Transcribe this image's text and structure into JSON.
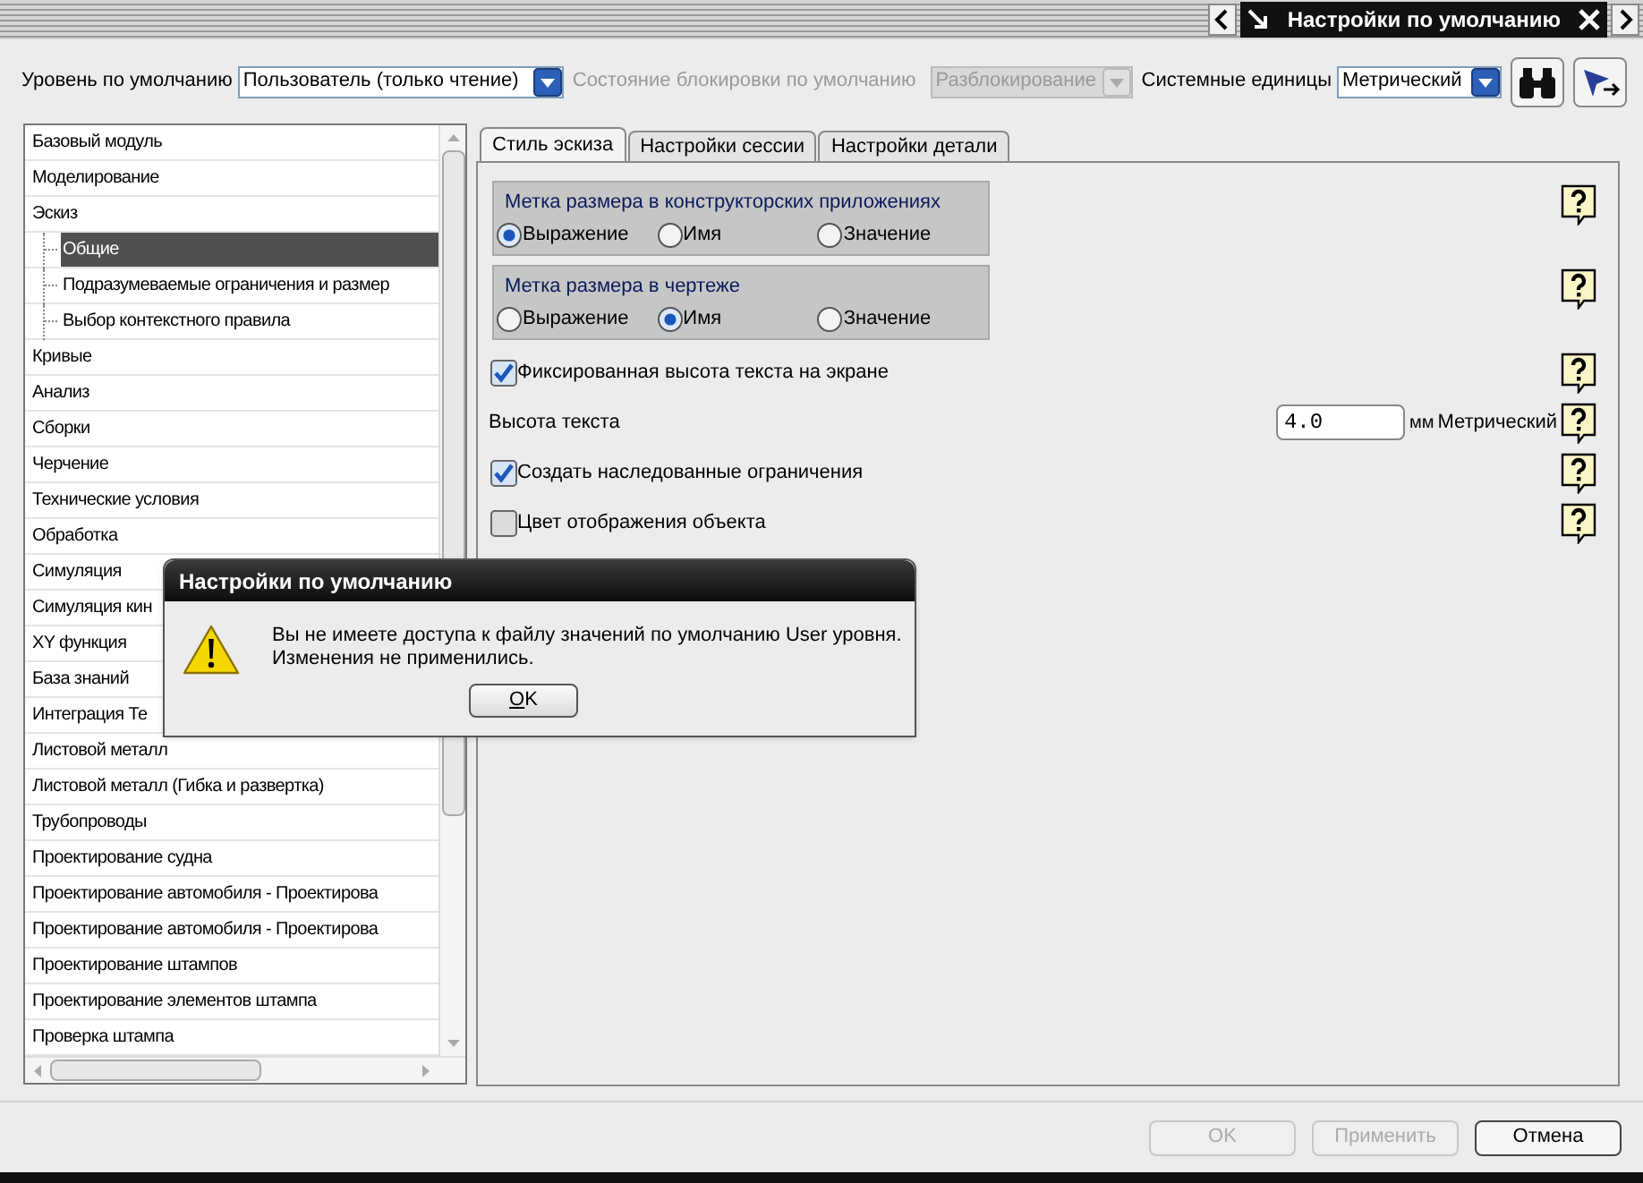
{
  "window": {
    "title": "Настройки по умолчанию"
  },
  "toolbar": {
    "default_level_label": "Уровень по умолчанию",
    "default_level": {
      "value": "Пользователь (только чтение)",
      "disabled": false
    },
    "lock_state_label": {
      "text": "Состояние блокировки по умолчанию",
      "disabled": true
    },
    "lock_state": {
      "value": "Разблокирование",
      "disabled": true
    },
    "units_label": "Системные единицы",
    "units": {
      "value": "Метрический",
      "disabled": false
    }
  },
  "sidebar": {
    "items": [
      {
        "label": "Базовый модуль",
        "selected": false
      },
      {
        "label": "Моделирование",
        "selected": false
      },
      {
        "label": "Эскиз",
        "selected": false,
        "children": [
          {
            "label": "Общие",
            "selected": true
          },
          {
            "label": "Подразумеваемые ограничения и размер",
            "selected": false
          },
          {
            "label": "Выбор контекстного правила",
            "selected": false
          }
        ]
      },
      {
        "label": "Кривые",
        "selected": false
      },
      {
        "label": "Анализ",
        "selected": false
      },
      {
        "label": "Сборки",
        "selected": false
      },
      {
        "label": "Черчение",
        "selected": false
      },
      {
        "label": "Технические условия",
        "selected": false
      },
      {
        "label": "Обработка",
        "selected": false
      },
      {
        "label": "Симуляция",
        "selected": false
      },
      {
        "label": "Симуляция кин",
        "selected": false
      },
      {
        "label": "XY функция",
        "selected": false
      },
      {
        "label": "База знаний",
        "selected": false
      },
      {
        "label": "Интеграция Те",
        "selected": false
      },
      {
        "label": "Листовой металл",
        "selected": false
      },
      {
        "label": "Листовой металл (Гибка и развертка)",
        "selected": false
      },
      {
        "label": "Трубопроводы",
        "selected": false
      },
      {
        "label": "Проектирование судна",
        "selected": false
      },
      {
        "label": "Проектирование автомобиля - Проектирова",
        "selected": false
      },
      {
        "label": "Проектирование автомобиля - Проектирова",
        "selected": false
      },
      {
        "label": "Проектирование штампов",
        "selected": false
      },
      {
        "label": "Проектирование элементов штампа",
        "selected": false
      },
      {
        "label": "Проверка штампа",
        "selected": false
      }
    ]
  },
  "tabs": [
    {
      "label": "Стиль эскиза",
      "selected": true
    },
    {
      "label": "Настройки сессии",
      "selected": false
    },
    {
      "label": "Настройки детали",
      "selected": false
    }
  ],
  "settings": [
    {
      "kind": "radio_group",
      "title": "Метка размера в конструкторских приложениях",
      "options": [
        {
          "label": "Выражение",
          "selected": true
        },
        {
          "label": "Имя",
          "selected": false
        },
        {
          "label": "Значение",
          "selected": false
        }
      ]
    },
    {
      "kind": "radio_group",
      "title": "Метка размера в чертеже",
      "options": [
        {
          "label": "Выражение",
          "selected": false
        },
        {
          "label": "Имя",
          "selected": true
        },
        {
          "label": "Значение",
          "selected": false
        }
      ]
    },
    {
      "kind": "checkbox",
      "label": "Фиксированная высота текста на экране",
      "checked": true
    },
    {
      "kind": "number",
      "label": "Высота текста",
      "value": "4.0",
      "unit": "мм",
      "system": "Метрический"
    },
    {
      "kind": "checkbox",
      "label": "Создать наследованные ограничения",
      "checked": true
    },
    {
      "kind": "checkbox",
      "label": "Цвет отображения объекта",
      "checked": false
    }
  ],
  "dialog": {
    "title": "Настройки по умолчанию",
    "message": [
      "Вы не имеете доступа к файлу значений по умолчанию User уровня.",
      "Изменения не применились."
    ],
    "button": {
      "label": "OK"
    }
  },
  "footer_buttons": [
    {
      "label": "OK",
      "disabled": true
    },
    {
      "label": "Применить",
      "disabled": true
    },
    {
      "label": "Отмена",
      "disabled": false
    }
  ]
}
